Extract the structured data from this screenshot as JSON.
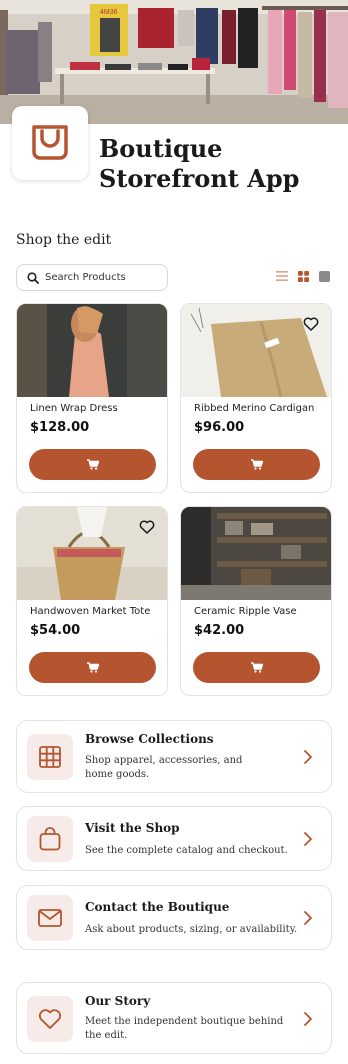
{
  "app": {
    "title_line1": "Boutique",
    "title_line2": "Storefront App",
    "accent": "#b55530"
  },
  "section": {
    "heading": "Shop the edit"
  },
  "search": {
    "placeholder": "Search Products"
  },
  "view_toggles": [
    "list-view-icon",
    "grid-view-icon",
    "gallery-view-icon"
  ],
  "products": [
    {
      "name": "Linen Wrap Dress",
      "price": "$128.00",
      "favorite_icon": false
    },
    {
      "name": "Ribbed Merino Cardigan",
      "price": "$96.00",
      "favorite_icon": true
    },
    {
      "name": "Handwoven Market Tote",
      "price": "$54.00",
      "favorite_icon": true
    },
    {
      "name": "Ceramic Ripple Vase",
      "price": "$42.00",
      "favorite_icon": false
    }
  ],
  "links": [
    {
      "title": "Browse Collections",
      "desc_line1": "Shop apparel, accessories, and",
      "desc_line2": "home goods.",
      "icon": "grid-icon"
    },
    {
      "title": "Visit the Shop",
      "desc_line1": "See the complete catalog and checkout.",
      "desc_line2": "",
      "icon": "shopping-bag-icon"
    },
    {
      "title": "Contact the Boutique",
      "desc_line1": "Ask about products, sizing, or availability.",
      "desc_line2": "",
      "icon": "mail-icon"
    },
    {
      "title": "Our Story",
      "desc_line1": "Meet the independent boutique behind",
      "desc_line2": "the edit.",
      "icon": "heart-icon"
    }
  ]
}
